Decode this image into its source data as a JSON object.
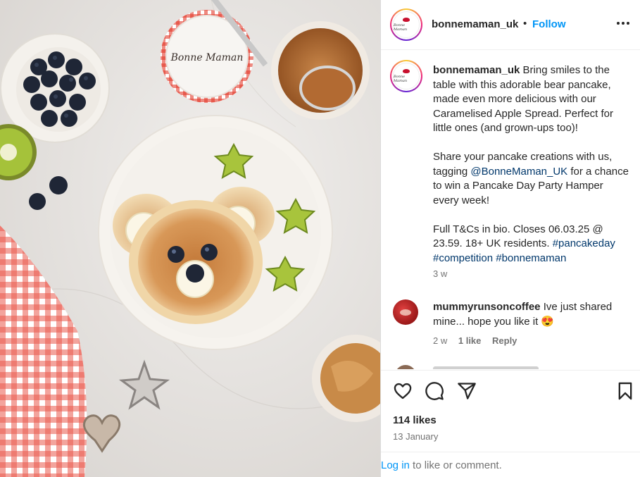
{
  "post": {
    "username": "bonnemaman_uk",
    "separator": "•",
    "follow_label": "Follow",
    "avatar_text": "Bonne Maman",
    "photo_label": "Bonne Maman"
  },
  "caption": {
    "username": "bonnemaman_uk",
    "para1": "Bring smiles to the table with this adorable bear pancake, made even more delicious with our Caramelised Apple Spread. Perfect for little ones (and grown-ups too)!",
    "para2_a": "Share your pancake creations with us, tagging ",
    "para2_mention": "@BonneMaman_UK",
    "para2_b": " for a chance to win a Pancake Day Party Hamper every week!",
    "para3_a": "Full T&Cs in bio. Closes 06.03.25 @ 23.59. 18+ UK residents. ",
    "hashtag1": "#pancakeday",
    "hashtag2": "#competition",
    "hashtag3": "#bonnemaman",
    "time": "3 w"
  },
  "comment1": {
    "username": "mummyrunsoncoffee",
    "text": "Ive just shared mine... hope you like it 😍",
    "time": "2 w",
    "likes": "1 like",
    "reply_label": "Reply"
  },
  "footer": {
    "likes": "114 likes",
    "date": "13 January",
    "login_link": "Log in",
    "login_text": " to like or comment."
  },
  "icons": [
    "heart-icon",
    "comment-icon",
    "share-icon",
    "bookmark-icon",
    "more-icon"
  ],
  "colors": {
    "accent": "#0095f6",
    "link": "#00376b",
    "muted": "#737373",
    "text": "#262626"
  }
}
